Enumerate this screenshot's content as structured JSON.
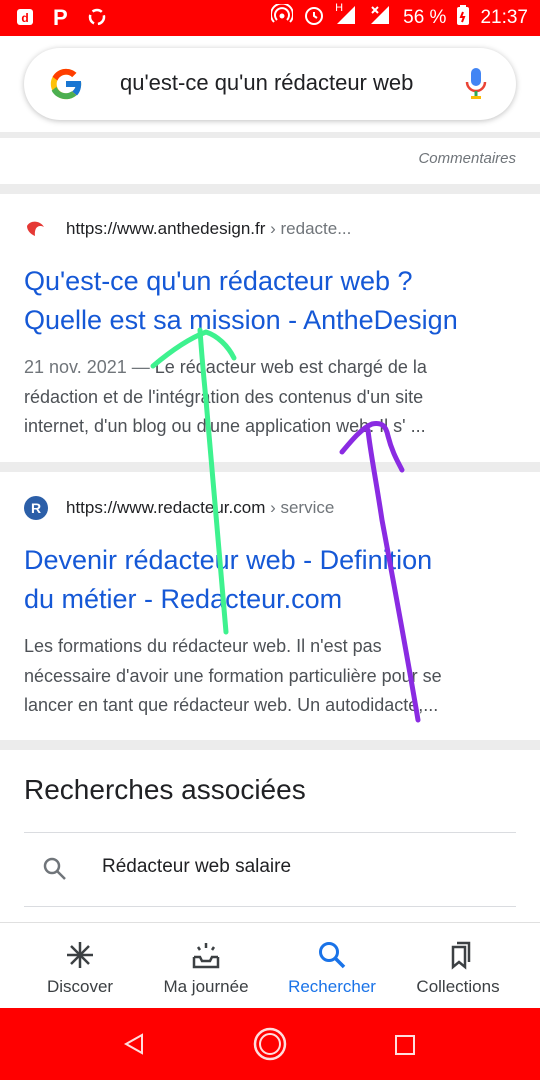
{
  "status_bar": {
    "network": "H",
    "battery": "56 %",
    "time": "21:37",
    "color": "#ff0000"
  },
  "search": {
    "query": "qu'est-ce qu'un rédacteur web"
  },
  "comments_label": "Commentaires",
  "results": [
    {
      "url": "https://www.anthedesign.fr",
      "crumb": " › redacte...",
      "title_line1": "Qu'est-ce qu'un rédacteur web ?",
      "title_line2": "Quelle est sa mission - AntheDesign",
      "date": "21 nov. 2021 —",
      "snippet_line1": " Le rédacteur web est chargé de la",
      "snippet_line2": "rédaction et de l'intégration des contenus d'un site",
      "snippet_line3": "internet, d'un blog ou d'une application web. Il s' ..."
    },
    {
      "url": "https://www.redacteur.com",
      "crumb": " › service",
      "favicon_letter": "R",
      "title_line1": "Devenir rédacteur web - Definition",
      "title_line2": "du métier - Redacteur.com",
      "snippet_line1": "Les formations du rédacteur web. Il n'est pas",
      "snippet_line2": "nécessaire d'avoir une formation particulière pour se",
      "snippet_line3": "lancer en tant que rédacteur web. Un autodidacte,..."
    }
  ],
  "related": {
    "title": "Recherches associées",
    "items": [
      "Rédacteur web salaire"
    ]
  },
  "bottom_nav": [
    {
      "label": "Discover",
      "icon": "asterisk-icon"
    },
    {
      "label": "Ma journée",
      "icon": "sunrise-inbox-icon"
    },
    {
      "label": "Rechercher",
      "icon": "search-icon",
      "active": true
    },
    {
      "label": "Collections",
      "icon": "bookmarks-icon"
    }
  ],
  "colors": {
    "link": "#1558d6",
    "active_nav": "#1a73e8",
    "annotation_green": "#3ef28f",
    "annotation_purple": "#8a2be2"
  }
}
